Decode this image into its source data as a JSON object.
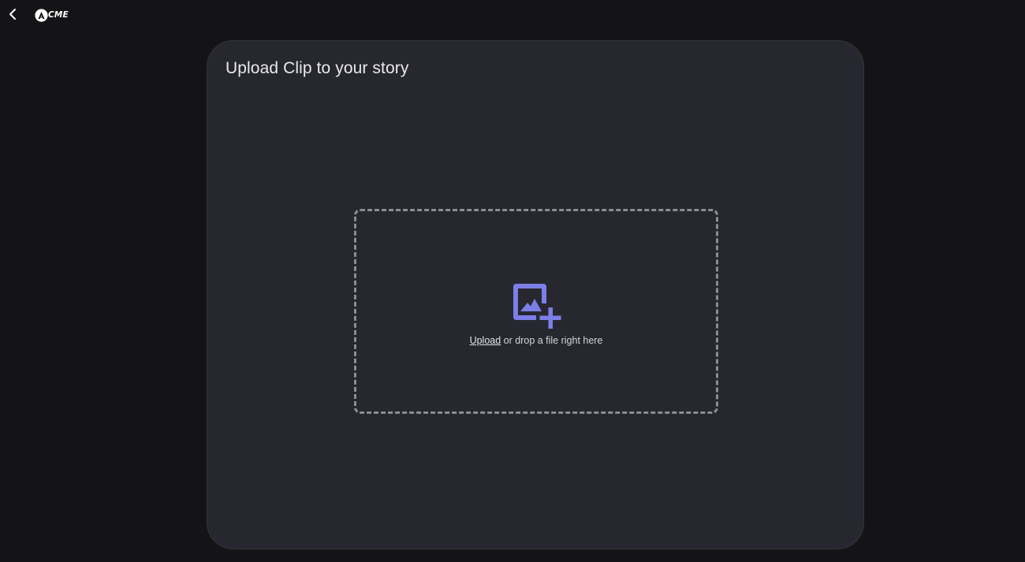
{
  "header": {
    "back_icon": "chevron-left-icon",
    "logo_text": "CME",
    "logo_mark_letter": "A"
  },
  "upload_card": {
    "title": "Upload Clip to your story",
    "dropzone": {
      "icon": "add-photo-icon",
      "link_label": "Upload",
      "hint_text": " or drop a file right here"
    }
  },
  "colors": {
    "page_background": "#141416",
    "card_background": "#272730",
    "accent": "#7b7fe6",
    "dashed_border": "#8c8c94"
  }
}
